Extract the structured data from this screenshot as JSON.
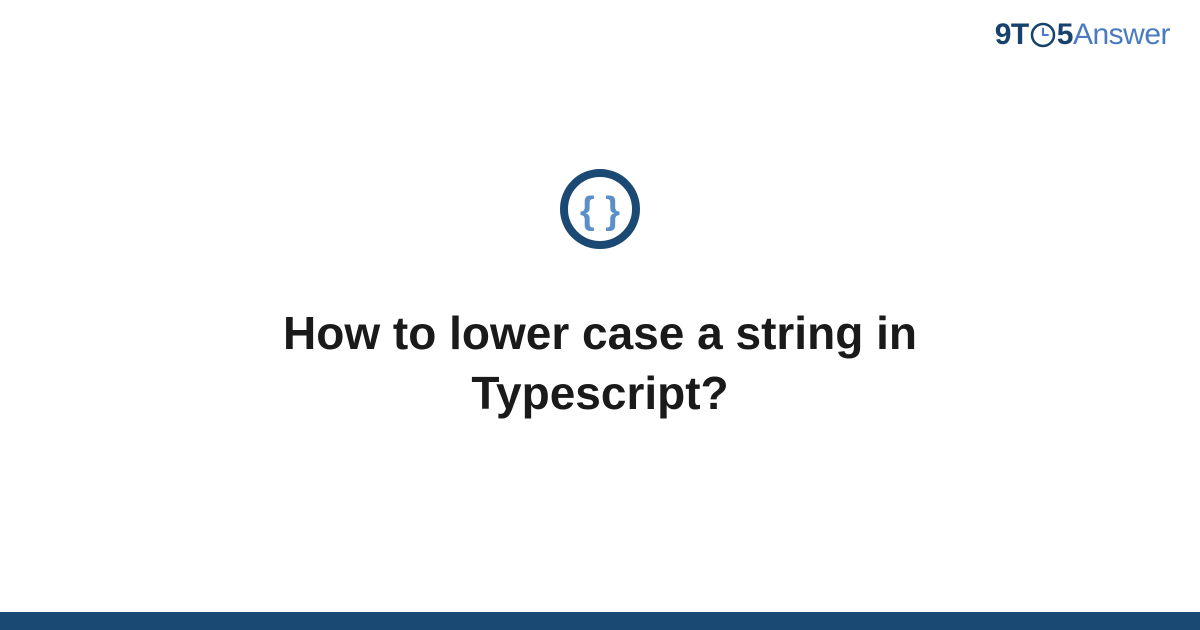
{
  "brand": {
    "part1": "9T",
    "part2": "5",
    "part3": "Answer"
  },
  "card": {
    "title": "How to lower case a string in Typescript?",
    "category_icon": "code-braces-icon"
  },
  "colors": {
    "primary_dark": "#16426c",
    "primary_light": "#4a7bc0",
    "icon_inner": "#5a8fc7",
    "footer": "#1a4a73"
  }
}
